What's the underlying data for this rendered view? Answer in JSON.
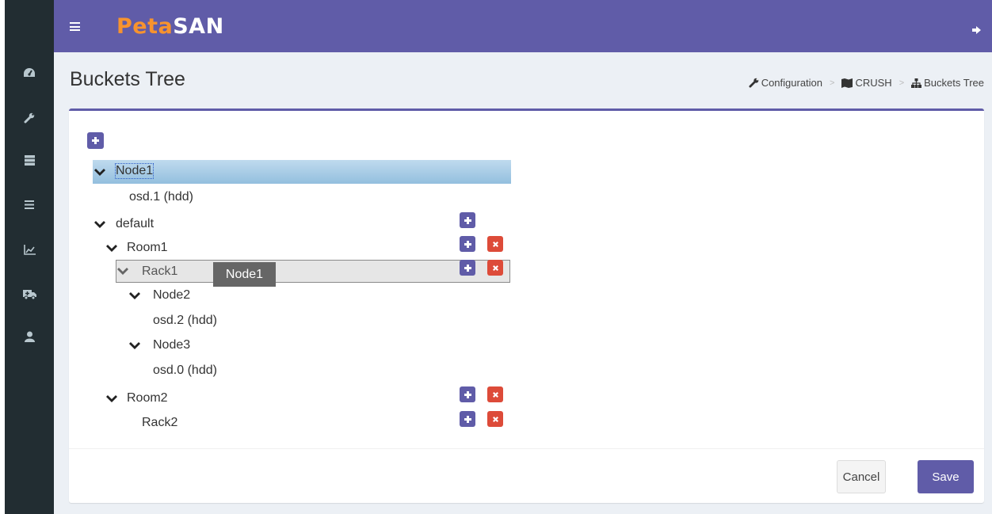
{
  "header": {
    "logo_part1": "Peta",
    "logo_part2": "SAN",
    "accent_color": "#605ca8"
  },
  "sidebar": {
    "icons": [
      "dashboard-icon",
      "wrench-icon",
      "server-icon",
      "list-icon",
      "chart-icon",
      "ambulance-icon",
      "user-icon"
    ]
  },
  "page": {
    "title": "Buckets Tree"
  },
  "breadcrumb": [
    {
      "icon": "wrench-icon",
      "label": "Configuration"
    },
    {
      "icon": "map-icon",
      "label": "CRUSH"
    },
    {
      "icon": "sitemap-icon",
      "label": "Buckets Tree"
    }
  ],
  "tree": {
    "node1": "Node1",
    "osd1": "osd.1 (hdd)",
    "default": "default",
    "room1": "Room1",
    "rack1": "Rack1",
    "node2": "Node2",
    "osd2": "osd.2 (hdd)",
    "node3": "Node3",
    "osd0": "osd.0 (hdd)",
    "room2": "Room2",
    "rack2": "Rack2"
  },
  "drag_tooltip": "Node1",
  "actions": {
    "cancel": "Cancel",
    "save": "Save"
  },
  "colors": {
    "add_button": "#605ca8",
    "delete_button": "#dd4b39",
    "selected_row": "#a9cde8"
  }
}
